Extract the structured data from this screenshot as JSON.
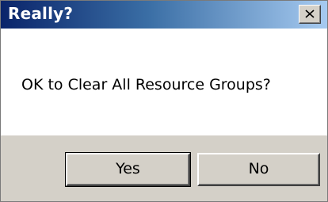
{
  "dialog": {
    "title": "Really?",
    "close_icon": "close-icon",
    "message": "OK to Clear All Resource Groups?",
    "buttons": {
      "yes_label": "Yes",
      "no_label": "No"
    },
    "colors": {
      "titlebar_start": "#0a246a",
      "titlebar_end": "#a6caf0",
      "button_face": "#d4d0c8",
      "title_text": "#ffffff"
    }
  }
}
